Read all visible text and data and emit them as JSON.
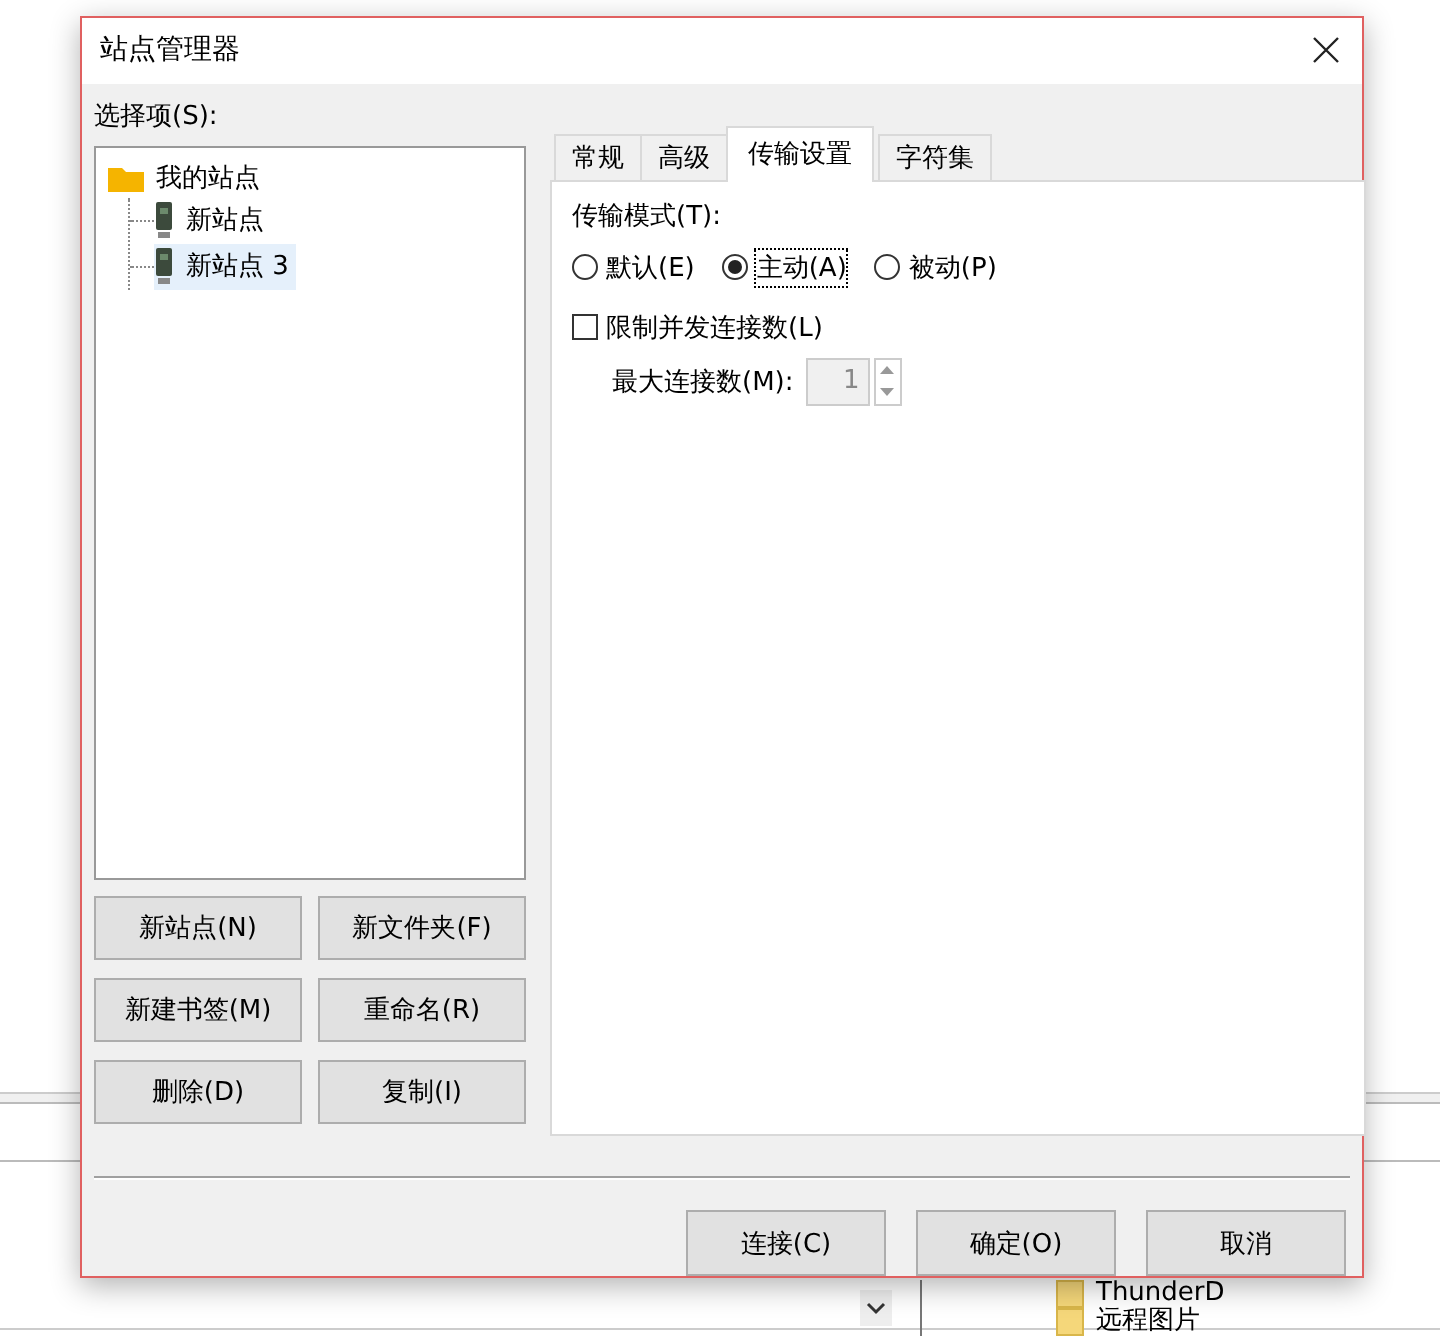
{
  "background": {
    "files": [
      {
        "name": "ThunderD"
      },
      {
        "name": "远程图片"
      }
    ]
  },
  "window": {
    "title": "站点管理器"
  },
  "left": {
    "label": "选择项(S):",
    "tree": [
      {
        "label": "我的站点",
        "kind": "folder",
        "selected": false,
        "children": [
          {
            "label": "新站点",
            "kind": "site",
            "selected": false
          },
          {
            "label": "新站点 3",
            "kind": "site",
            "selected": true
          }
        ]
      }
    ],
    "buttons": [
      "新站点(N)",
      "新文件夹(F)",
      "新建书签(M)",
      "重命名(R)",
      "删除(D)",
      "复制(I)"
    ]
  },
  "tabs": [
    {
      "label": "常规",
      "selected": false
    },
    {
      "label": "高级",
      "selected": false
    },
    {
      "label": "传输设置",
      "selected": true
    },
    {
      "label": "字符集",
      "selected": false
    }
  ],
  "transfer": {
    "mode_label": "传输模式(T):",
    "modes": [
      {
        "label": "默认(E)",
        "selected": false
      },
      {
        "label": "主动(A)",
        "selected": true
      },
      {
        "label": "被动(P)",
        "selected": false
      }
    ],
    "limit": {
      "label": "限制并发连接数(L)",
      "checked": false
    },
    "max": {
      "label": "最大连接数(M):",
      "value": "1",
      "disabled": true
    }
  },
  "footer_buttons": [
    "连接(C)",
    "确定(O)",
    "取消"
  ]
}
